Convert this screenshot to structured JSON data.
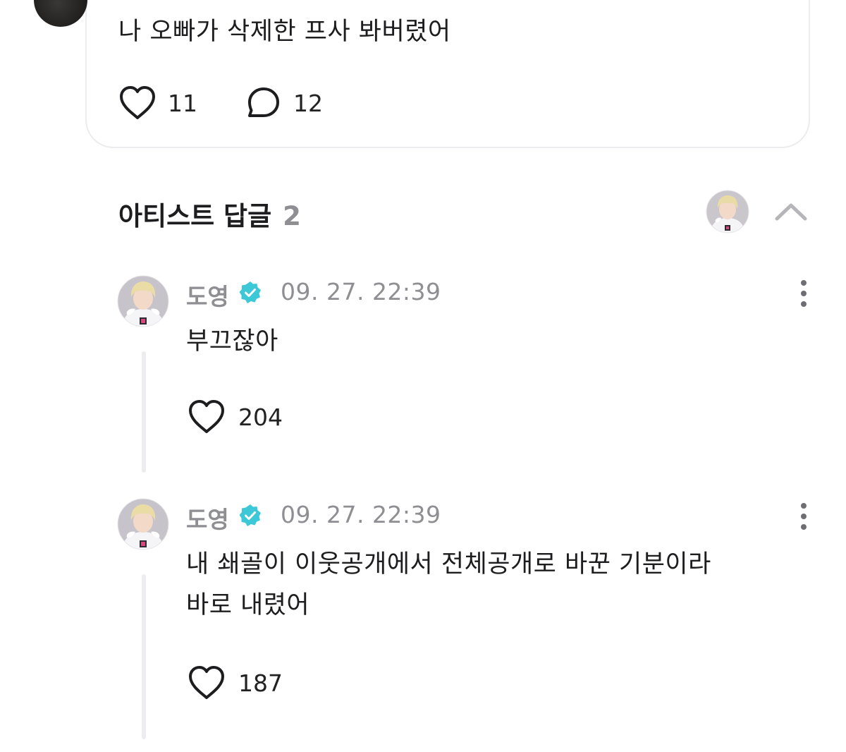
{
  "post": {
    "text": "나 오빠가 삭제한 프사 봐버렸어",
    "like_count": "11",
    "comment_count": "12"
  },
  "artist_replies": {
    "title": "아티스트 답글",
    "count": "2",
    "replies": [
      {
        "name": "도영",
        "timestamp": "09. 27. 22:39",
        "text": "부끄잖아",
        "like_count": "204"
      },
      {
        "name": "도영",
        "timestamp": "09. 27. 22:39",
        "text": "내 쇄골이 이웃공개에서 전체공개로 바꾼 기분이라\n바로 내렸어",
        "like_count": "187"
      }
    ]
  },
  "colors": {
    "verified": "#3cc8d6",
    "muted_text": "#8e8e93",
    "thread_line": "#ededf0"
  },
  "icons": [
    "heart-icon",
    "comment-bubble-icon",
    "verified-badge-icon",
    "more-vertical-icon",
    "chevron-up-icon"
  ]
}
